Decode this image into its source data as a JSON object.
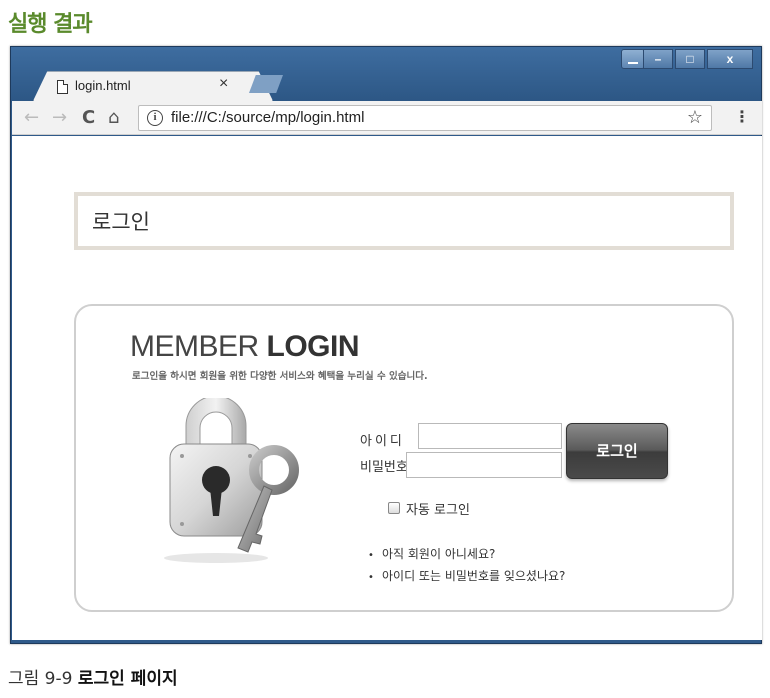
{
  "heading": "실행 결과",
  "browser": {
    "tab_title": "login.html",
    "tab_close": "×",
    "window_controls": {
      "minimize": "–",
      "maximize": "□",
      "close": "x"
    },
    "nav": {
      "back": "←",
      "forward": "→",
      "reload": "C",
      "home": "⌂"
    },
    "info_icon": "i",
    "url": "file:///C:/source/mp/login.html",
    "star": "☆",
    "menu": "⋮"
  },
  "page": {
    "header_title": "로그인",
    "member_title_light": "MEMBER ",
    "member_title_bold": "LOGIN",
    "member_subtitle": "로그인을 하시면 회원을 위한 다양한 서비스와 혜택을 누리실 수 있습니다.",
    "id_label": "아이디",
    "pw_label": "비밀번호",
    "id_value": "",
    "pw_value": "",
    "login_button": "로그인",
    "auto_login_label": "자동 로그인",
    "auto_login_checked": false,
    "links": [
      "아직 회원이 아니세요?",
      "아이디 또는 비밀번호를 잊으셨나요?"
    ],
    "bullet": "•"
  },
  "caption": {
    "number": "그림 9-9 ",
    "title": "로그인 페이지"
  },
  "colors": {
    "heading": "#5a8a2c",
    "window_frame": "#2f5a8a",
    "header_border": "#e2ddd5",
    "button_dark": "#4a4a4a"
  }
}
